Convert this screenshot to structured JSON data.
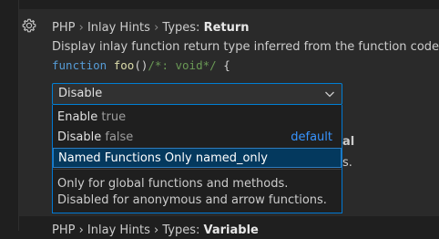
{
  "setting": {
    "breadcrumb_1": "PHP",
    "sep_1": "›",
    "breadcrumb_2": "Inlay Hints",
    "sep_2": "›",
    "breadcrumb_3": "Types:",
    "name": "Return",
    "description": "Display inlay function return type inferred from the function code.",
    "code": {
      "keyword": "function",
      "fname": "foo",
      "parens": "()",
      "comment": "/*: void*/",
      "brace": "{"
    },
    "gear_icon": "gear-icon"
  },
  "select": {
    "value": "Disable",
    "chevron_icon": "chevron-down-icon",
    "options": [
      {
        "label": "Enable",
        "value": "true",
        "badge": ""
      },
      {
        "label": "Disable",
        "value": "false",
        "badge": "default"
      },
      {
        "label": "Named Functions Only",
        "value": "named_only",
        "badge": ""
      }
    ],
    "selected_description": "Only for global functions and methods. Disabled for anonymous and arrow functions."
  },
  "peek": {
    "right_1": "al",
    "right_2": "s."
  },
  "next_setting": {
    "prefix": "PHP › Inlay Hints › Types:",
    "name": "Variable"
  },
  "colors": {
    "accent": "#007fd4",
    "selected_bg": "#04395e",
    "default_badge": "#3794ff"
  }
}
